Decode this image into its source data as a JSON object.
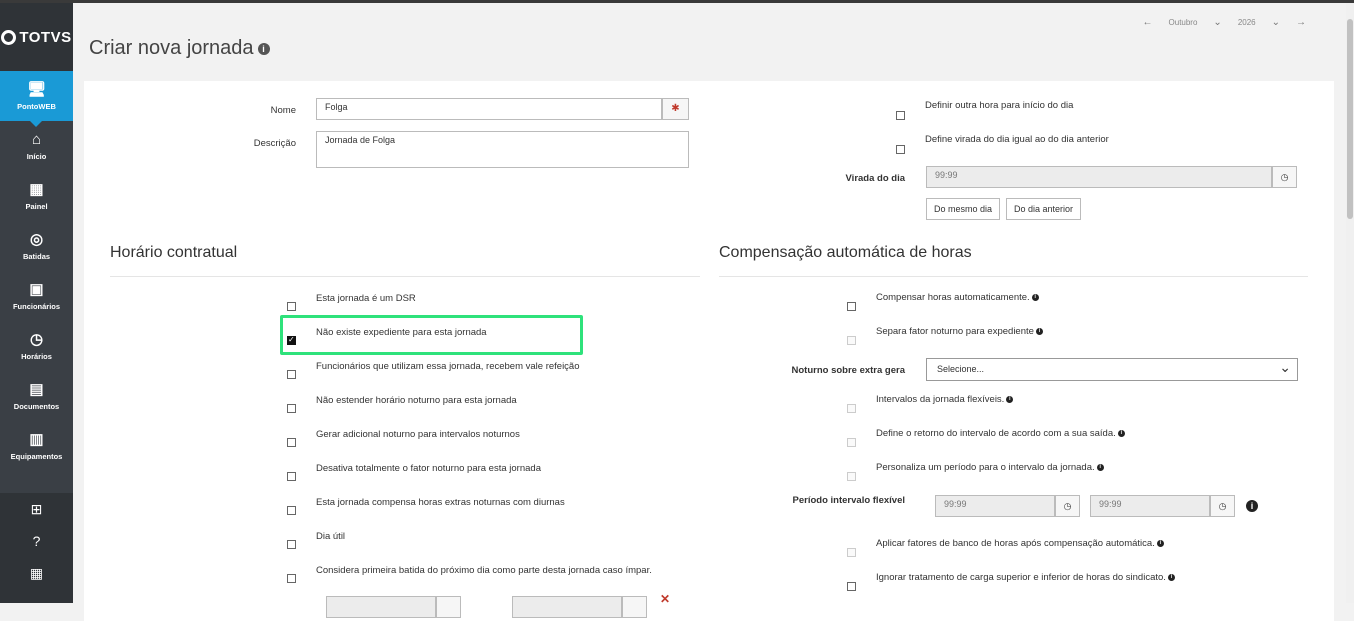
{
  "brand": {
    "name": "TOTVS"
  },
  "sidebar": {
    "items": [
      {
        "label": "PontoWEB",
        "icon": "monitor-icon"
      },
      {
        "label": "Início",
        "icon": "home-icon"
      },
      {
        "label": "Painel",
        "icon": "dashboard-icon"
      },
      {
        "label": "Batidas",
        "icon": "fingerprint-icon"
      },
      {
        "label": "Funcionários",
        "icon": "badge-icon"
      },
      {
        "label": "Horários",
        "icon": "clock-icon"
      },
      {
        "label": "Documentos",
        "icon": "document-icon"
      },
      {
        "label": "Equipamentos",
        "icon": "device-icon"
      }
    ],
    "bottom": [
      "grid-icon",
      "help-icon",
      "building-icon"
    ]
  },
  "date_nav": {
    "month": "Outubro",
    "year": "2026"
  },
  "page": {
    "title": "Criar nova jornada"
  },
  "form": {
    "nome_label": "Nome",
    "nome_value": "Folga",
    "descricao_label": "Descrição",
    "descricao_value": "Jornada de Folga",
    "definir_outra_hora": "Definir outra hora para início do dia",
    "define_virada": "Define virada do dia igual ao do dia anterior",
    "virada_label": "Virada do dia",
    "virada_value": "99:99",
    "btn_mesmo_dia": "Do mesmo dia",
    "btn_dia_anterior": "Do dia anterior"
  },
  "horario": {
    "title": "Horário contratual",
    "options": [
      {
        "label": "Esta jornada é um DSR",
        "checked": false
      },
      {
        "label": "Não existe expediente para esta jornada",
        "checked": true
      },
      {
        "label": "Funcionários que utilizam essa jornada, recebem vale refeição",
        "checked": false
      },
      {
        "label": "Não estender horário noturno para esta jornada",
        "checked": false
      },
      {
        "label": "Gerar adicional noturno para intervalos noturnos",
        "checked": false
      },
      {
        "label": "Desativa totalmente o fator noturno para esta jornada",
        "checked": false
      },
      {
        "label": "Esta jornada compensa horas extras noturnas com diurnas",
        "checked": false
      },
      {
        "label": "Dia útil",
        "checked": false
      },
      {
        "label": "Considera primeira batida do próximo dia como parte desta jornada caso ímpar.",
        "checked": false
      }
    ]
  },
  "compensacao": {
    "title": "Compensação automática de horas",
    "compensar": "Compensar horas automaticamente.",
    "separa": "Separa fator noturno para expediente",
    "noturno_label": "Noturno sobre extra gera",
    "noturno_select": "Selecione...",
    "intervalos": "Intervalos da jornada flexíveis.",
    "define_retorno": "Define o retorno do intervalo de acordo com a sua saída.",
    "personaliza": "Personaliza um período para o intervalo da jornada.",
    "periodo_label": "Período intervalo flexível",
    "periodo_inicio": "99:99",
    "periodo_fim": "99:99",
    "aplicar": "Aplicar fatores de banco de horas após compensação automática.",
    "ignorar": "Ignorar tratamento de carga superior e inferior de horas do sindicato."
  }
}
